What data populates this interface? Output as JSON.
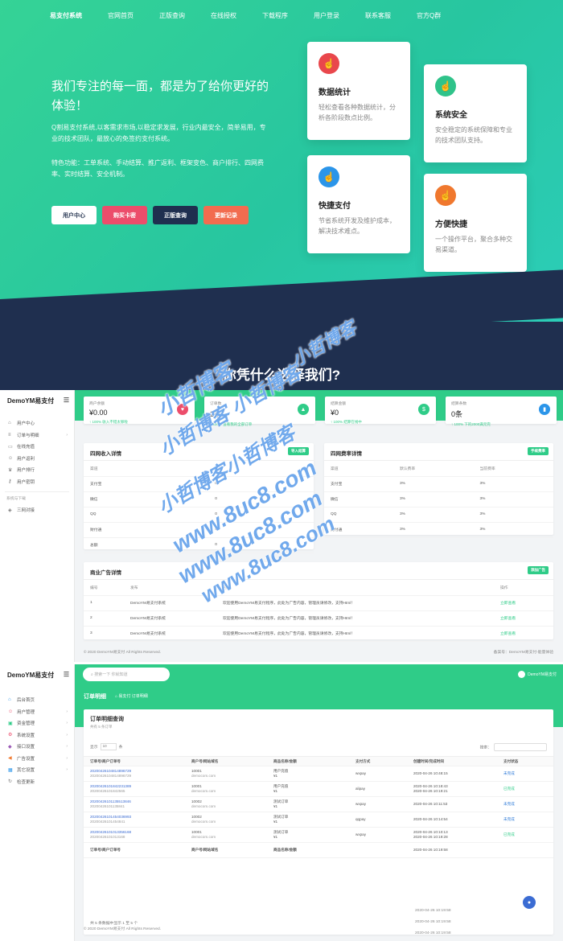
{
  "nav": [
    "易支付系统",
    "官网首页",
    "正版查询",
    "在线授权",
    "下载程序",
    "用户登录",
    "联系客服",
    "官方Q群"
  ],
  "hero": {
    "title": "我们专注的每一面，都是为了给你更好的体验！",
    "desc": "Q割易支付系统,以客需求市场,以稳定求发展，行业内最安全，简单易用，专业的技术团队，最放心的免签约支付系统。",
    "features": "特色功能：工单系统、手动结算、推广返利、框架变色、商户排行、四网费率、实时结算、安全机制。",
    "buttons": [
      "用户中心",
      "购买卡密",
      "正版查询",
      "更新记录"
    ]
  },
  "features": [
    {
      "title": "数据统计",
      "desc": "轻松查看各种数据统计，分析各阶段数点比例。",
      "icon": "heart-icon",
      "color": "#e9474c"
    },
    {
      "title": "系统安全",
      "desc": "安全稳定的系统保障和专业的技术团队支持。",
      "icon": "thumbs-up-icon",
      "color": "#2fc38a"
    },
    {
      "title": "快捷支付",
      "desc": "节省系统开发及维护成本，解决技术难点。",
      "icon": "thumbs-up-icon",
      "color": "#2b95e9"
    },
    {
      "title": "方便快捷",
      "desc": "一个操作平台，聚合多种交易渠道。",
      "icon": "thumbs-up-icon",
      "color": "#f0782e"
    }
  ],
  "section_title": "你凭什么选择我们?",
  "admin1": {
    "brand": "DemoYM易支付",
    "menu": [
      "用户中心",
      "订单与明细",
      "在线充值",
      "用户返利",
      "用户排行",
      "用户密钥"
    ],
    "menu_head": "系统与下载",
    "menu_extra": "三网对接",
    "stats": [
      {
        "label": "商户余额",
        "value": "¥0.00",
        "note": "↑ 100% 收入不错太够啦",
        "color": "#ec4d6b",
        "icon": "heart-icon"
      },
      {
        "label": "订单数",
        "value": "2条",
        "note": "↑ 100% 查看我的全部订单",
        "color": "#2fcc88",
        "icon": "chart-icon"
      },
      {
        "label": "结算金额",
        "value": "¥0",
        "note": "↑ 100% 结算在线中",
        "color": "#2fcc88",
        "icon": "money-icon"
      },
      {
        "label": "结算条数",
        "value": "0条",
        "note": "↑ 100% 下的2000满元完",
        "color": "#2b95e9",
        "icon": "bars-icon"
      }
    ],
    "income": {
      "title": "四网收入详情",
      "btn": "导入结算",
      "cols": [
        "渠道",
        "支付"
      ],
      "rows": [
        [
          "支付宝",
          "0"
        ],
        [
          "微信",
          "0"
        ],
        [
          "QQ",
          "0"
        ],
        [
          "财付通",
          "0"
        ],
        [
          "总额",
          "0"
        ]
      ]
    },
    "rates": {
      "title": "四网费率详情",
      "btn": "手续费率",
      "cols": [
        "渠道",
        "默认费率",
        "当前费率"
      ],
      "rows": [
        [
          "支付宝",
          "3%",
          "3%"
        ],
        [
          "微信",
          "3%",
          "3%"
        ],
        [
          "QQ",
          "3%",
          "3%"
        ],
        [
          "财付通",
          "3%",
          "3%"
        ]
      ]
    },
    "ads": {
      "title": "商业广告详情",
      "btn": "添加广告",
      "cols": [
        "编号",
        "发布",
        "内容",
        "操作"
      ],
      "rows": [
        [
          "1",
          "DemoYM易支付系统",
          "欢迎使用DemoYM易支付程序，此处为广告内容，管理员请修改，支持Html！",
          "立即查看"
        ],
        [
          "2",
          "DemoYM易支付系统",
          "欢迎使用DemoYM易支付程序，此处为广告内容，管理员请修改，支持Html！",
          "立即查看"
        ],
        [
          "3",
          "DemoYM易支付系统",
          "欢迎使用DemoYM易支付程序，此处为广告内容，管理员请修改，支持Html！",
          "立即查看"
        ]
      ]
    },
    "footer_left": "© 2020 DemoYM易支付 All Rights Reserved.",
    "footer_right": "备案号：DemoYM易支付-能量体验"
  },
  "admin2": {
    "brand": "DemoYM易支付",
    "menu": [
      "后台首页",
      "用户管理",
      "资金管理",
      "系统设置",
      "接口设置",
      "广告设置",
      "其它设置",
      "检查更新"
    ],
    "search_placeholder": "搜索一下 你就知道",
    "user": "DemoYM易支付",
    "page_title": "订单明细",
    "breadcrumb": "⌂   易支付   订单明细",
    "panel_title": "订单明细查询",
    "panel_sub": "共有 5 条订单",
    "show_label": "显示",
    "show_val": "10",
    "show_unit": "条",
    "search_label": "搜索：",
    "cols": [
      "订单号/商户订单号",
      "商户号/网站域名",
      "商品名称/金额",
      "支付方式",
      "创建时间/完成时间",
      "支付状态"
    ],
    "rows": [
      [
        "20200426104814896729",
        "20200426104814896729",
        "10001",
        "democom.com",
        "用户充值",
        "¥1",
        "wxpay",
        "2020-04-26 10:48:15",
        "",
        "未完成"
      ],
      [
        "20200426101842231389",
        "20200426101842565",
        "10001",
        "democom.com",
        "用户充值",
        "¥1",
        "alipay",
        "2020-04-26 10:18:43",
        "2020-04-26 10:19:21",
        "已完成"
      ],
      [
        "20200426101135513846",
        "20200426101135841",
        "10002",
        "democom.com",
        "测试订单",
        "¥1",
        "wxpay",
        "2020-04-26 10:11:53",
        "",
        "未完成"
      ],
      [
        "20200426101454036993",
        "20200426101454841",
        "10002",
        "democom.com",
        "测试订单",
        "¥1",
        "qqpay",
        "2020-04-26 10:14:54",
        "",
        "未完成"
      ],
      [
        "20200426101013356168",
        "20200426101013168",
        "10001",
        "democom.com",
        "测试订单",
        "¥1",
        "wxpay",
        "2020-04-26 10:10:13",
        "2020-04-26 10:19:28",
        "已完成"
      ]
    ],
    "footer_cols": [
      "订单号/商户订单号",
      "商户号/网站域名",
      "商品名称/金额"
    ],
    "extra_times": [
      "2020-04-26 10:19:58",
      "2020-04-26 10:19:58",
      "2020-04-26 10:19:58",
      "2020-04-26 10:19:58"
    ],
    "summary": "共 5 条数据中显示 1 至 5 个",
    "footer": "© 2020 DemoYM易支付 All Rights Reserved."
  },
  "watermarks": [
    "小哲博客",
    "小哲博客",
    "小哲博客 小哲博客",
    "小哲博客",
    "小哲博客小哲博客",
    "www.8uc8.com",
    "www.8uc8.com",
    "www.8uc8.com",
    "www.8uc8.com",
    "www.8uc8.com"
  ]
}
